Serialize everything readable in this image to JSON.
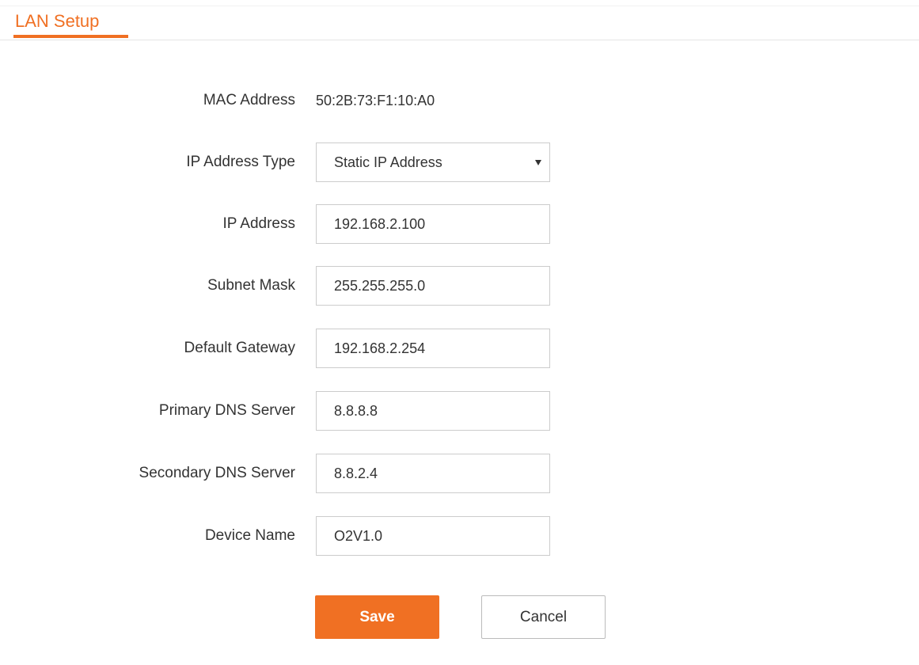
{
  "header": {
    "title": "LAN Setup"
  },
  "form": {
    "mac_address": {
      "label": "MAC Address",
      "value": "50:2B:73:F1:10:A0"
    },
    "ip_address_type": {
      "label": "IP Address Type",
      "value": "Static IP Address"
    },
    "ip_address": {
      "label": "IP Address",
      "value": "192.168.2.100"
    },
    "subnet_mask": {
      "label": "Subnet Mask",
      "value": "255.255.255.0"
    },
    "default_gateway": {
      "label": "Default Gateway",
      "value": "192.168.2.254"
    },
    "primary_dns": {
      "label": "Primary DNS Server",
      "value": "8.8.8.8"
    },
    "secondary_dns": {
      "label": "Secondary DNS Server",
      "value": "8.8.2.4"
    },
    "device_name": {
      "label": "Device Name",
      "value": "O2V1.0"
    }
  },
  "buttons": {
    "save_label": "Save",
    "cancel_label": "Cancel"
  },
  "colors": {
    "accent": "#f07023",
    "text": "#333333",
    "border": "#cccccc"
  },
  "icons": {
    "select_arrow": "dropdown-arrow-icon"
  }
}
